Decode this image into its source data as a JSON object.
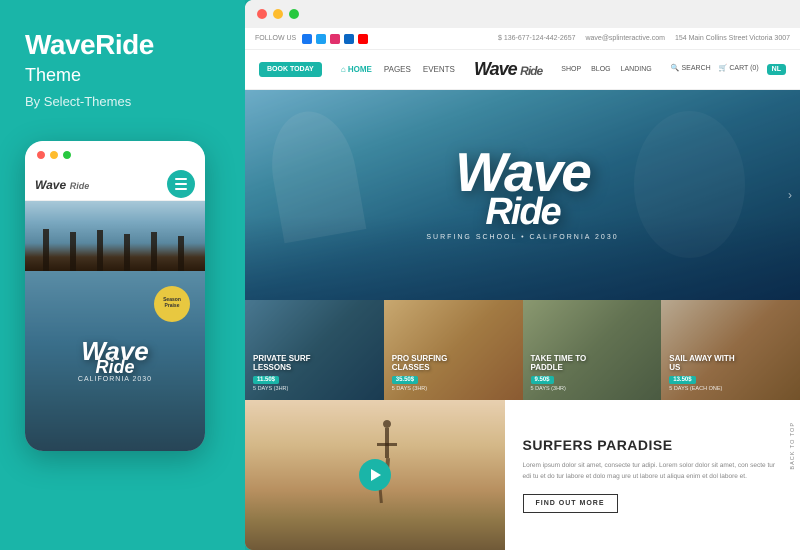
{
  "left": {
    "brand_title": "WaveRide",
    "brand_subtitle": "Theme",
    "brand_by": "By Select-Themes",
    "mobile_logo": "Wave",
    "mobile_logo_sub": "Ride",
    "season_badge": "Season\nPraise",
    "mobile_wave_big": "Wave",
    "mobile_wave_script": "Ride",
    "mobile_tagline": "CALIFORNIA 2030"
  },
  "browser": {
    "dots": [
      "#ff5f57",
      "#febc2e",
      "#28c840"
    ]
  },
  "site": {
    "top_bar": {
      "follow_us": "FOLLOW US",
      "phone": "$ 136-677-124-442-2657",
      "email": "wave@splinteractive.com",
      "address": "154 Main Collins Street Victoria 3007"
    },
    "nav": {
      "book_btn": "BOOK TODAY",
      "links": [
        "HOME",
        "PAGES",
        "EVENTS"
      ],
      "logo": "Wave Ride",
      "right_links": [
        "SHOP",
        "BLOG",
        "LANDING"
      ],
      "search": "SEARCH",
      "cart": "CART (0)",
      "icon": "NL"
    },
    "hero": {
      "logo_line1": "Wave",
      "logo_line2": "Ride",
      "tagline": "SURFING SCHOOL • CALIFORNIA 2030"
    },
    "cards": [
      {
        "title": "PRIVATE SURF\nLESSONS",
        "badge": "11.50$",
        "meta": "5 DAYS (3HR)"
      },
      {
        "title": "PRO SURFING\nCLASSES",
        "badge": "35.50$",
        "meta": "5 DAYS (3HR)"
      },
      {
        "title": "TAKE TIME TO\nPADDLE",
        "badge": "9.50$",
        "meta": "5 DAYS (3HR)"
      },
      {
        "title": "SAIL AWAY WITH\nUS",
        "badge": "13.50$",
        "meta": "5 DAYS (EACH ONE)"
      }
    ],
    "surfers_paradise": {
      "title": "SURFERS PARADISE",
      "text": "Lorem ipsum dolor sit amet, consecte tur adipi. Lorem solor dolor sit amet, con secte tur edi tu et do tur labore  et dolo mag ure ut labore ut aliqua enim et dol labore et.",
      "find_out_btn": "FIND OUT MORE"
    },
    "back_to_top": "BACK TO TOP"
  }
}
